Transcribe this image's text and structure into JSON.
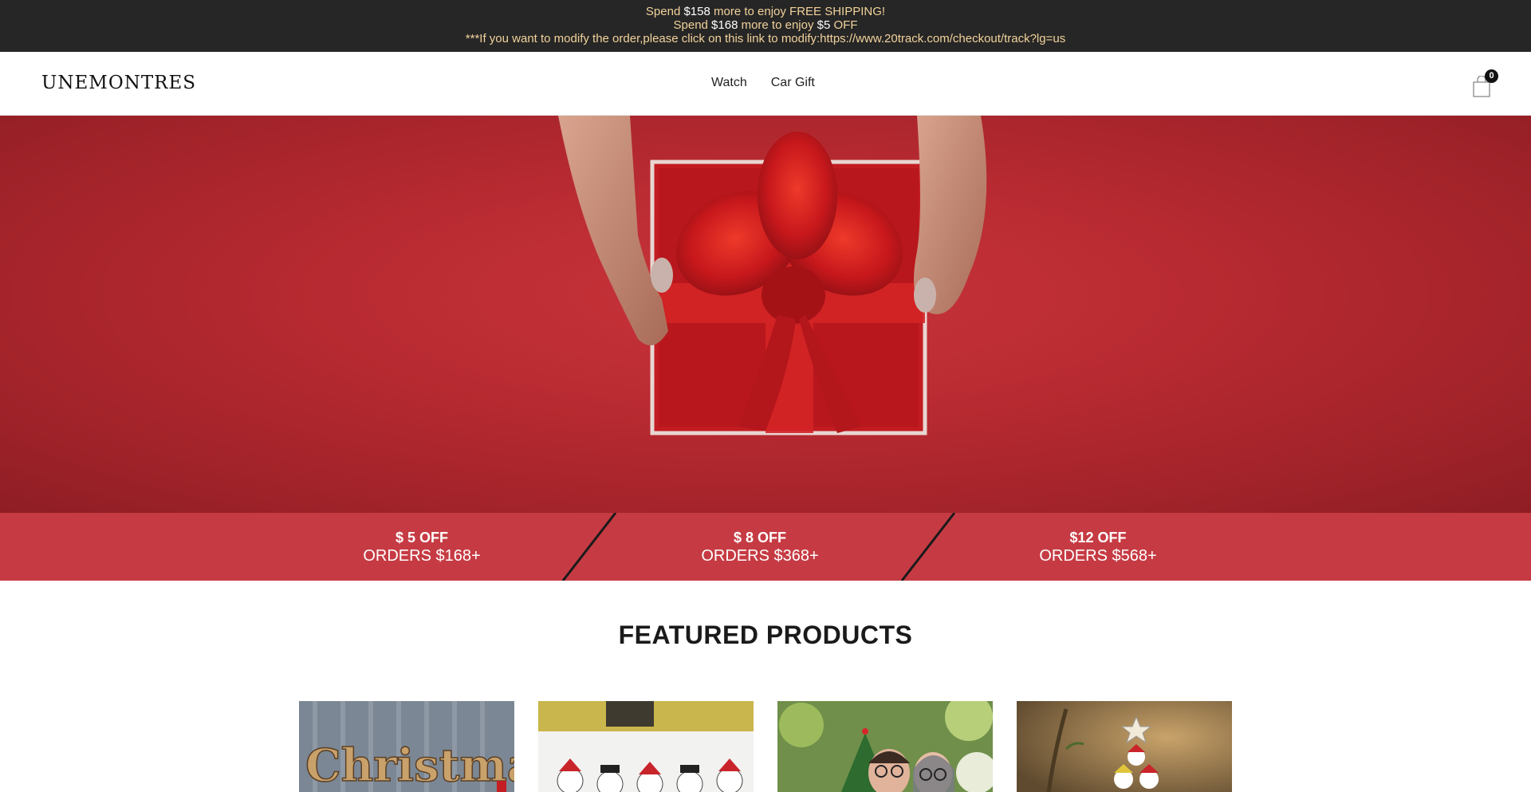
{
  "announcement": {
    "line1_pre": "Spend ",
    "line1_amount": "$158",
    "line1_post": " more to enjoy FREE SHIPPING!",
    "line2_pre": "Spend ",
    "line2_amount": "$168",
    "line2_mid": " more to enjoy ",
    "line2_discount": "$5",
    "line2_post": " OFF",
    "line3": "***If you want to modify the order,please click on this link to modify:https://www.20track.com/checkout/track?lg=us"
  },
  "header": {
    "logo": "UNEMONTRES",
    "nav": [
      {
        "label": "Watch"
      },
      {
        "label": "Car Gift"
      }
    ],
    "cart_count": "0",
    "cart_icon": "shopping-bag-icon"
  },
  "discounts": [
    {
      "amount": "$ 5 OFF",
      "orders": "ORDERS $168+"
    },
    {
      "amount": "$ 8 OFF",
      "orders": "ORDERS $368+"
    },
    {
      "amount": "$12 OFF",
      "orders": "ORDERS $568+"
    }
  ],
  "featured": {
    "title": "FEATURED PRODUCTS"
  },
  "colors": {
    "announcement_bg": "#262626",
    "announcement_text": "#f2d29b",
    "discount_band": "#c63b43",
    "hero_red": "#b82a31"
  }
}
